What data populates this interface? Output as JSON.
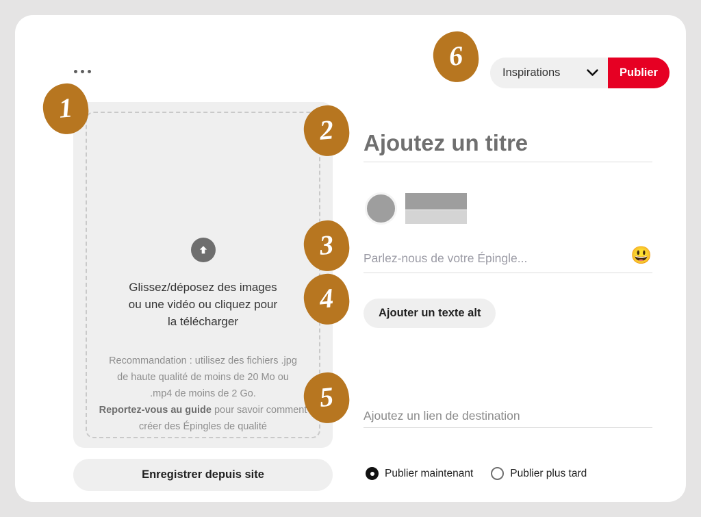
{
  "theme": {
    "page_background": "#e5e4e4",
    "card_background": "#ffffff",
    "accent_red": "#e60023",
    "badge_orange": "#b77620",
    "placeholder_gray": "#9b9ba5",
    "panel_gray": "#efefef"
  },
  "header": {
    "overflow_menu_icon": "ellipsis-icon",
    "board_select": {
      "value": "Inspirations",
      "chevron_icon": "chevron-down-icon"
    },
    "publish_button_label": "Publier"
  },
  "uploader": {
    "arrow_icon": "upload-arrow-icon",
    "primary_text": "Glissez/déposez des images\nou une vidéo ou cliquez pour\nla télécharger",
    "recommendation_text": "Recommandation : utilisez des fichiers .jpg\nde haute qualité de moins de 20 Mo ou\n.mp4 de moins de 2 Go.",
    "guide_link_text": "Reportez-vous au guide",
    "guide_rest_text": " pour savoir comment créer des Épingles de qualité",
    "save_from_site_label": "Enregistrer depuis site"
  },
  "details": {
    "title_placeholder": "Ajoutez un titre",
    "title_value": "",
    "author_avatar": "avatar",
    "description_placeholder": "Parlez-nous de votre Épingle...",
    "description_value": "",
    "emoji_picker_icon": "😃",
    "alt_text_button_label": "Ajouter un texte alt",
    "destination_link_placeholder": "Ajoutez un lien de destination",
    "destination_link_value": ""
  },
  "schedule": {
    "options": [
      {
        "label": "Publier maintenant",
        "selected": true
      },
      {
        "label": "Publier plus tard",
        "selected": false
      }
    ]
  },
  "annotations": [
    {
      "id": 1,
      "number": "1"
    },
    {
      "id": 2,
      "number": "2"
    },
    {
      "id": 3,
      "number": "3"
    },
    {
      "id": 4,
      "number": "4"
    },
    {
      "id": 5,
      "number": "5"
    },
    {
      "id": 6,
      "number": "6"
    }
  ]
}
